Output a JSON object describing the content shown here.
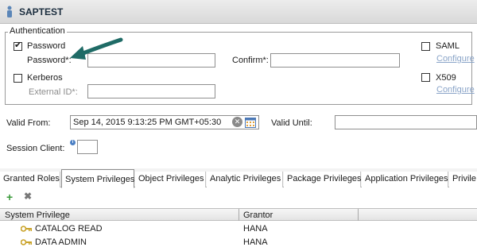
{
  "window": {
    "title": "SAPTEST"
  },
  "auth": {
    "legend": "Authentication",
    "password": {
      "label": "Password",
      "checked": true,
      "field_label": "Password*:",
      "value": ""
    },
    "confirm": {
      "label": "Confirm*:",
      "value": ""
    },
    "kerberos": {
      "label": "Kerberos",
      "checked": false,
      "external_id_label": "External ID*:",
      "value": ""
    },
    "saml": {
      "label": "SAML",
      "checked": false,
      "configure": "Configure"
    },
    "x509": {
      "label": "X509",
      "checked": false,
      "configure": "Configure"
    },
    "checkmark": "✔"
  },
  "validity": {
    "from_label": "Valid From:",
    "from_value": "Sep 14, 2015 9:13:25 PM GMT+05:30",
    "until_label": "Valid Until:",
    "until_value": ""
  },
  "session": {
    "label": "Session Client:",
    "value": ""
  },
  "tabs": [
    {
      "label": "Granted Roles",
      "active": false
    },
    {
      "label": "System Privileges",
      "active": true
    },
    {
      "label": "Object Privileges",
      "active": false
    },
    {
      "label": "Analytic Privileges",
      "active": false
    },
    {
      "label": "Package Privileges",
      "active": false
    },
    {
      "label": "Application Privileges",
      "active": false
    },
    {
      "label": "Privile",
      "active": false
    }
  ],
  "toolbar": {
    "add_symbol": "+",
    "remove_symbol": "✖"
  },
  "grid": {
    "columns": [
      "System Privilege",
      "Grantor"
    ],
    "rows": [
      {
        "privilege": "CATALOG READ",
        "grantor": "HANA"
      },
      {
        "privilege": "DATA ADMIN",
        "grantor": "HANA"
      }
    ]
  },
  "icons": {
    "title": "user-icon",
    "info": "info-icon",
    "clear": "clear-icon",
    "calendar": "calendar-icon",
    "key": "key-icon",
    "annotation": "arrow-annotation"
  },
  "colors": {
    "accent_link": "#8aa4c8",
    "info": "#4a7fc4",
    "add_green": "#3a9a3a",
    "remove_gray": "#777777",
    "arrow_teal": "#1f6b66"
  }
}
